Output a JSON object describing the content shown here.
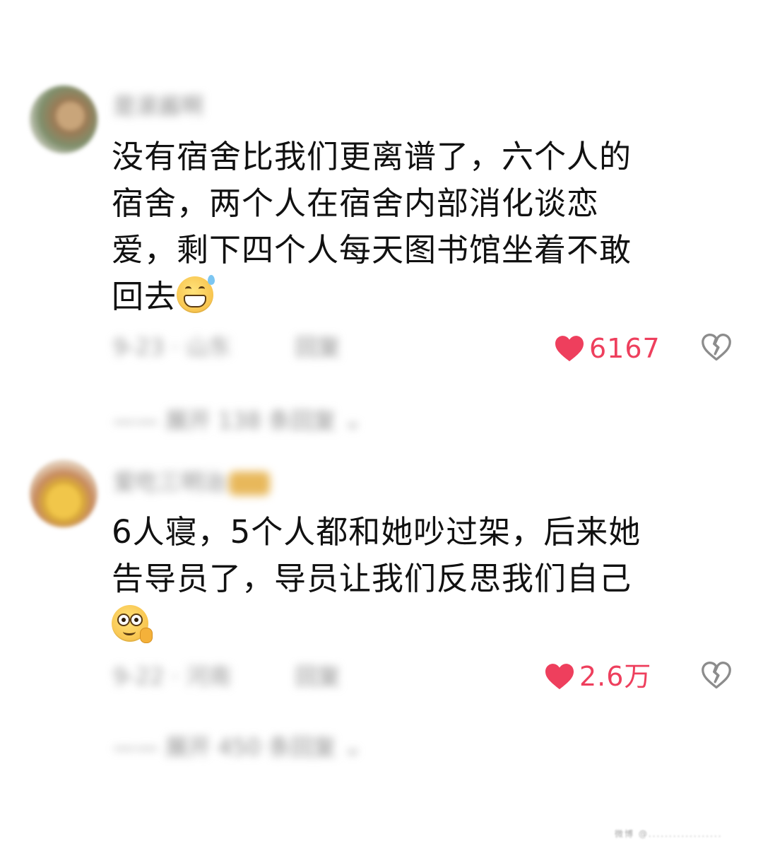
{
  "comments": [
    {
      "username": "是滚酱啊",
      "text": "没有宿舍比我们更离谱了，六个人的\n宿舍，两个人在宿舍内部消化谈恋\n爱，剩下四个人每天图书馆坐着不敢\n回去",
      "emoji": "grinning-sweat-emoji",
      "date_location": "9-23 · 山东",
      "reply_label": "回复",
      "like_count": "6167",
      "expand_label": "—— 展开 138 条回复"
    },
    {
      "username": "爱吃三明治",
      "text": "6人寝，5个人都和她吵过架，后来她\n告导员了，导员让我们反思我们自己\n",
      "emoji": "wide-eyed-emoji",
      "date_location": "9-22 · 河南",
      "reply_label": "回复",
      "like_count": "2.6万",
      "expand_label": "—— 展开 450 条回复"
    }
  ],
  "watermark": "微博 @..................",
  "colors": {
    "like": "#ee3f5d",
    "text": "#111111",
    "muted": "#9a9a9a"
  },
  "icons": {
    "like": "heart-icon",
    "dislike": "broken-heart-icon",
    "expand": "chevron-down-icon"
  }
}
